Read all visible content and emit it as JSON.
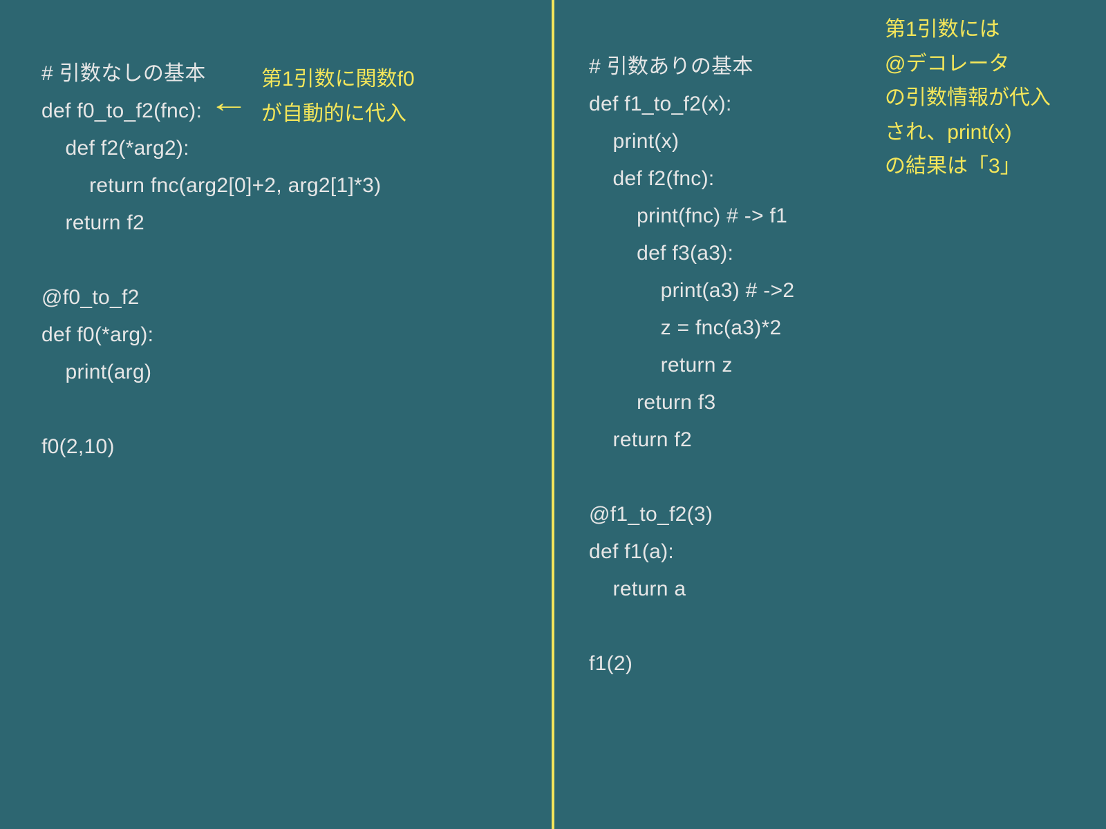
{
  "left": {
    "code": "# 引数なしの基本\ndef f0_to_f2(fnc):\n    def f2(*arg2):\n        return fnc(arg2[0]+2, arg2[1]*3)\n    return f2\n\n@f0_to_f2\ndef f0(*arg):\n    print(arg)\n\nf0(2,10)",
    "note": "第1引数に関数f0\nが自動的に代入",
    "arrow": "←"
  },
  "right": {
    "code": "# 引数ありの基本\ndef f1_to_f2(x):\n    print(x)\n    def f2(fnc):\n        print(fnc) # -> f1\n        def f3(a3):\n            print(a3) # ->2\n            z = fnc(a3)*2\n            return z\n        return f3\n    return f2\n\n@f1_to_f2(3)\ndef f1(a):\n    return a\n\nf1(2)",
    "note": "第1引数には\n@デコレータ\nの引数情報が代入\nされ、print(x)\nの結果は「3」",
    "arrow": "←"
  }
}
